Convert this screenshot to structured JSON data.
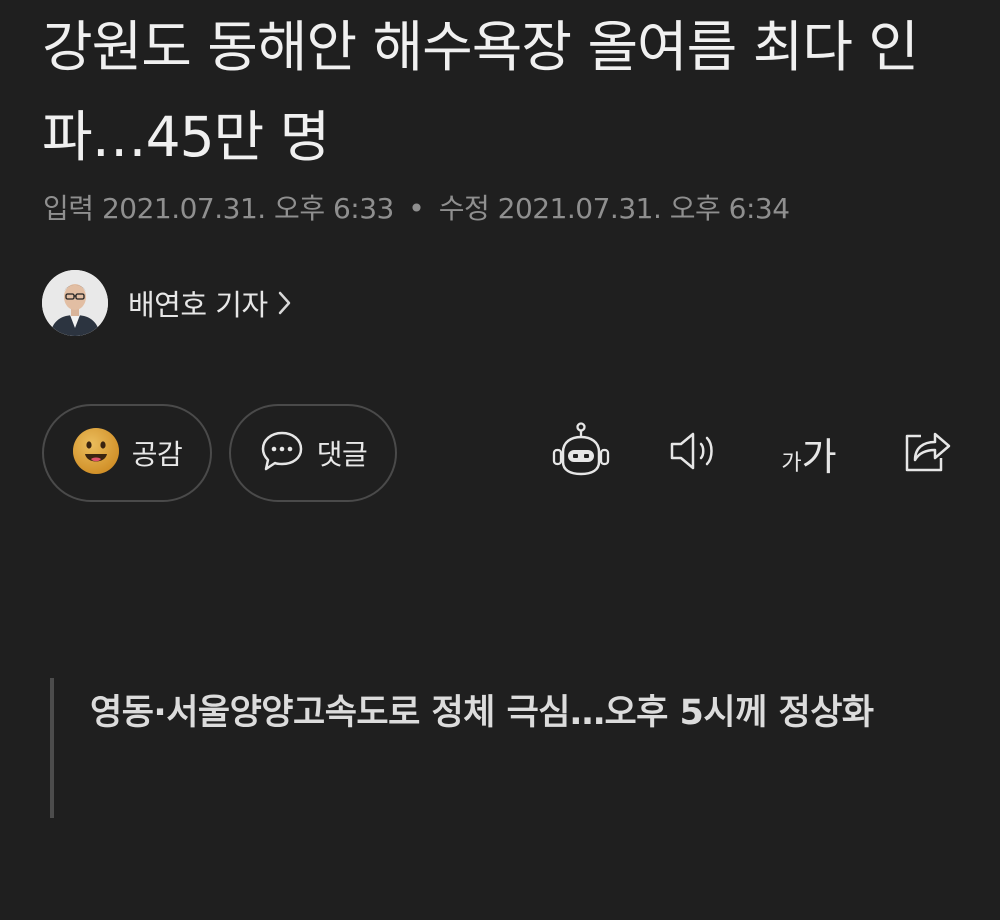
{
  "article": {
    "headline": "강원도 동해안 해수욕장 올여름 최다 인파…45만 명",
    "published_label": "입력",
    "published_at": "2021.07.31. 오후 6:33",
    "separator": "•",
    "modified_label": "수정",
    "modified_at": "2021.07.31. 오후 6:34",
    "subheadline": "영동·서울양양고속도로 정체 극심…오후 5시께 정상화"
  },
  "author": {
    "name": "배연호 기자",
    "avatar_icon": "reporter-photo"
  },
  "actions": {
    "like_label": "공감",
    "like_icon": "smiley-emoji-icon",
    "comment_label": "댓글",
    "comment_icon": "speech-bubble-icon"
  },
  "toolbar": {
    "summary_icon": "robot-icon",
    "tts_icon": "speaker-icon",
    "font_small": "가",
    "font_big": "가",
    "share_icon": "share-icon"
  },
  "colors": {
    "background": "#1f1f1f",
    "text": "#f0f0f0",
    "muted": "#8f8f8f",
    "border": "#4a4a4a",
    "emoji": "#e0a030"
  }
}
